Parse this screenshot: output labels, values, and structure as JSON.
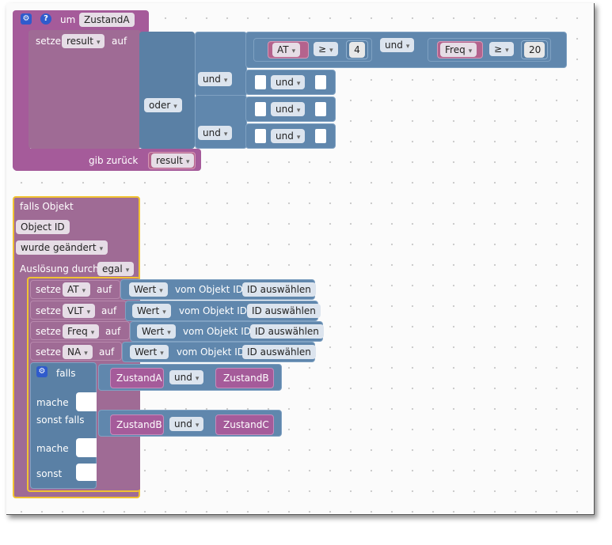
{
  "function_block": {
    "prefix": "um",
    "name": "ZustandA",
    "set_label": "setze",
    "variable": "result",
    "to_label": "auf",
    "top_row": {
      "left_var": "AT",
      "left_op": "≥",
      "left_value": "4",
      "join": "und",
      "right_var": "Freq",
      "right_op": "≥",
      "right_value": "20"
    },
    "and_label": "und",
    "or_label": "oder",
    "return_label": "gib zurück",
    "return_var": "result"
  },
  "trigger_block": {
    "title": "falls Objekt",
    "object_field": "Object ID",
    "event": "wurde geändert",
    "trigger_label": "Auslösung durch",
    "trigger_value": "egal",
    "assignments": [
      {
        "set": "setze",
        "var": "AT",
        "to": "auf",
        "prop": "Wert",
        "from": "vom Objekt ID",
        "select": "ID auswählen"
      },
      {
        "set": "setze",
        "var": "VLT",
        "to": "auf",
        "prop": "Wert",
        "from": "vom Objekt ID",
        "select": "ID auswählen"
      },
      {
        "set": "setze",
        "var": "Freq",
        "to": "auf",
        "prop": "Wert",
        "from": "vom Objekt ID",
        "select": "ID auswählen"
      },
      {
        "set": "setze",
        "var": "NA",
        "to": "auf",
        "prop": "Wert",
        "from": "vom Objekt ID",
        "select": "ID auswählen"
      }
    ],
    "if_label": "falls",
    "if_cond": {
      "a": "ZustandA",
      "op": "und",
      "b": "ZustandB"
    },
    "do_label": "mache",
    "elseif_label": "sonst falls",
    "elseif_cond": {
      "a": "ZustandB",
      "op": "und",
      "b": "ZustandC"
    },
    "do2_label": "mache",
    "else_label": "sonst"
  },
  "colors": {
    "procedure": "#a55b9a",
    "logic": "#5a80a5",
    "variable": "#b4638d",
    "selected_outline": "#f1c232"
  }
}
